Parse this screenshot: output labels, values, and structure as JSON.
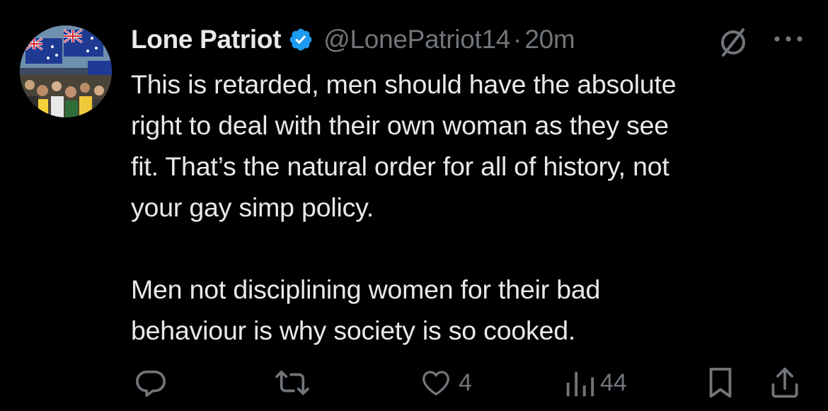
{
  "author": {
    "display_name": "Lone Patriot",
    "handle": "@LonePatriot14",
    "separator": "·",
    "time": "20m"
  },
  "tweet": {
    "text": "This is retarded, men should have the absolute\nright to deal with their own woman as they see\nfit. That’s the natural order for all of history, not\nyour gay simp policy.\n\nMen not disciplining women for their bad\nbehaviour is why society is so cooked."
  },
  "actions": {
    "reply_count": "",
    "retweet_count": "",
    "like_count": "4",
    "view_count": "44"
  },
  "icons": {
    "verified": "verified-badge-icon",
    "grok": "grok-icon",
    "more": "more-icon",
    "reply": "reply-icon",
    "retweet": "retweet-icon",
    "like": "heart-icon",
    "views": "views-icon",
    "bookmark": "bookmark-icon",
    "share": "share-icon"
  },
  "colors": {
    "background": "#000000",
    "text": "#e7e9ea",
    "secondary": "#71767b",
    "verified": "#1d9bf0"
  }
}
